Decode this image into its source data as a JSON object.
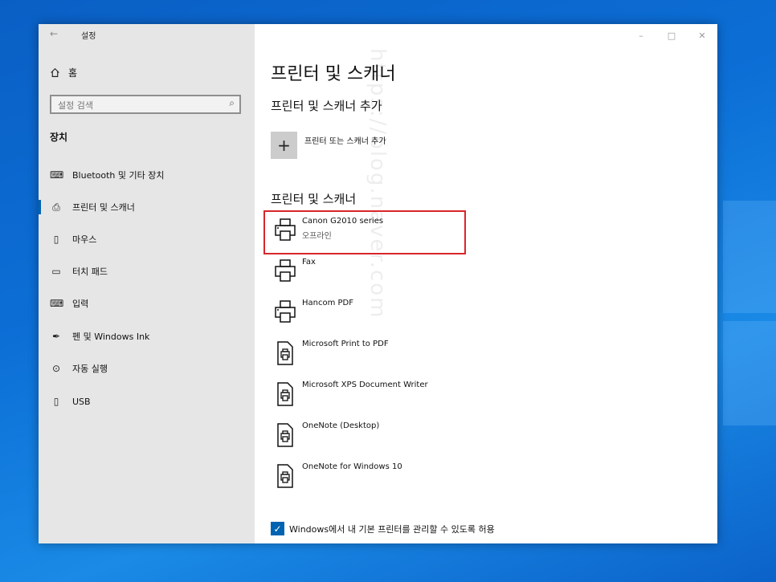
{
  "window": {
    "title": "설정",
    "back_glyph": "←"
  },
  "controls": {
    "minimize": "–",
    "maximize": "□",
    "close": "✕"
  },
  "sidebar": {
    "home_label": "홈",
    "search_placeholder": "설정 검색",
    "section_title": "장치",
    "items": [
      {
        "label": "Bluetooth 및 기타 장치",
        "icon": "keyboard-bluetooth-icon",
        "glyph": "⌨",
        "active": false
      },
      {
        "label": "프린터 및 스캐너",
        "icon": "printer-icon",
        "glyph": "⎙",
        "active": true
      },
      {
        "label": "마우스",
        "icon": "mouse-icon",
        "glyph": "▯",
        "active": false
      },
      {
        "label": "터치 패드",
        "icon": "touchpad-icon",
        "glyph": "▭",
        "active": false
      },
      {
        "label": "입력",
        "icon": "keyboard-icon",
        "glyph": "⌨",
        "active": false
      },
      {
        "label": "펜 및 Windows Ink",
        "icon": "pen-icon",
        "glyph": "✒",
        "active": false
      },
      {
        "label": "자동 실행",
        "icon": "autoplay-icon",
        "glyph": "⊙",
        "active": false
      },
      {
        "label": "USB",
        "icon": "usb-icon",
        "glyph": "▯",
        "active": false
      }
    ]
  },
  "main": {
    "page_title": "프린터 및 스캐너",
    "add_section_title": "프린터 및 스캐너 추가",
    "add_button_glyph": "+",
    "add_button_label": "프린터 또는 스캐너 추가",
    "list_section_title": "프린터 및 스캐너",
    "printers": [
      {
        "name": "Canon G2010 series",
        "status": "오프라인",
        "icon": "printer-icon",
        "highlighted": true
      },
      {
        "name": "Fax",
        "status": "",
        "icon": "printer-icon"
      },
      {
        "name": "Hancom PDF",
        "status": "",
        "icon": "printer-icon"
      },
      {
        "name": "Microsoft Print to PDF",
        "status": "",
        "icon": "document-printer-icon"
      },
      {
        "name": "Microsoft XPS Document Writer",
        "status": "",
        "icon": "document-printer-icon"
      },
      {
        "name": "OneNote (Desktop)",
        "status": "",
        "icon": "document-printer-icon"
      },
      {
        "name": "OneNote for Windows 10",
        "status": "",
        "icon": "document-printer-icon"
      }
    ],
    "default_printer_checkbox": {
      "label": "Windows에서 내 기본 프린터를 관리할 수 있도록 허용",
      "checked": true,
      "check_glyph": "✓"
    }
  },
  "watermark": "https://blog.naver.com",
  "colors": {
    "accent": "#0063b1",
    "highlight": "#d9262b",
    "sidebar_bg": "#e6e6e6"
  }
}
